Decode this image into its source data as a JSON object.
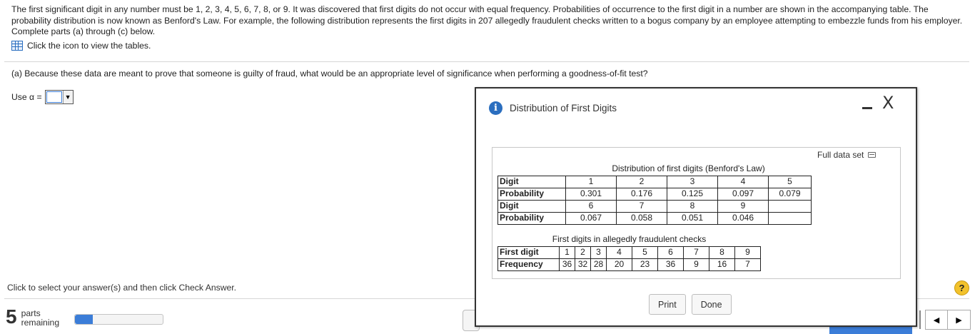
{
  "problem": {
    "intro": "The first significant digit in any number must be 1, 2, 3, 4, 5, 6, 7, 8, or 9. It was discovered that first digits do not occur with equal frequency. Probabilities of occurrence to the first digit in a number are shown in the accompanying table. The probability distribution is now known as Benford's Law. For example, the following distribution represents the first digits in 207 allegedly fraudulent checks written to a bogus company by an employee attempting to embezzle funds from his employer. Complete parts (a) through (c) below.",
    "tables_link": "Click the icon to view the tables.",
    "question": "(a) Because these data are meant to prove that someone is guilty of fraud, what would be an appropriate level of significance when performing a goodness-of-fit test?",
    "use_alpha_label": "Use α ="
  },
  "footer": {
    "instruction": "Click to select your answer(s) and then click Check Answer.",
    "parts_count": "5",
    "parts_label_1": "parts",
    "parts_label_2": "remaining",
    "help": "?",
    "progress_fraction": 0.2
  },
  "modal": {
    "title": "Distribution of First Digits",
    "close": "X",
    "full_data_set": "Full data set",
    "print_label": "Print",
    "done_label": "Done",
    "benford": {
      "caption": "Distribution of first digits (Benford's Law)",
      "rows": [
        {
          "label": "Digit",
          "cells": [
            "1",
            "2",
            "3",
            "4",
            "5"
          ]
        },
        {
          "label": "Probability",
          "cells": [
            "0.301",
            "0.176",
            "0.125",
            "0.097",
            "0.079"
          ]
        },
        {
          "label": "Digit",
          "cells": [
            "6",
            "7",
            "8",
            "9",
            ""
          ]
        },
        {
          "label": "Probability",
          "cells": [
            "0.067",
            "0.058",
            "0.051",
            "0.046",
            ""
          ]
        }
      ]
    },
    "fraud": {
      "caption": "First digits in allegedly fraudulent checks",
      "row_labels": [
        "First digit",
        "Frequency"
      ],
      "digits": [
        "1",
        "2",
        "3",
        "4",
        "5",
        "6",
        "7",
        "8",
        "9"
      ],
      "frequencies": [
        "36",
        "32",
        "28",
        "20",
        "23",
        "36",
        "9",
        "16",
        "7"
      ]
    }
  },
  "colors": {
    "accent": "#3b7dd8",
    "help_badge": "#f2c22c"
  }
}
